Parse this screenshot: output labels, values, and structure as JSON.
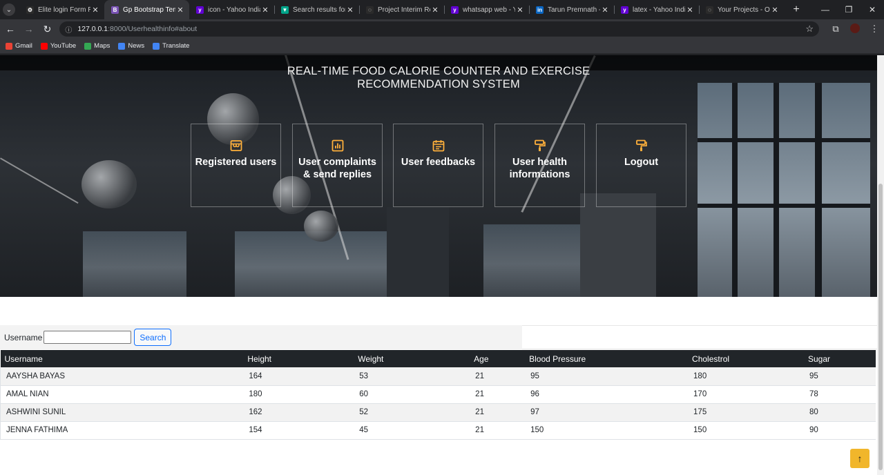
{
  "browser": {
    "tabs": [
      {
        "label": "Elite login Form Resp",
        "active": false,
        "favicon_color": "#2b2b2b",
        "favicon_glyph": "⚙"
      },
      {
        "label": "Gp Bootstrap Templat",
        "active": true,
        "favicon_color": "#7952b3",
        "favicon_glyph": "B"
      },
      {
        "label": "icon - Yahoo India Se",
        "active": false,
        "favicon_color": "#6001d2",
        "favicon_glyph": "y"
      },
      {
        "label": "Search results for Cal",
        "active": false,
        "favicon_color": "#00a389",
        "favicon_glyph": "▼"
      },
      {
        "label": "Project Interim Repor",
        "active": false,
        "favicon_color": "#2b2b2b",
        "favicon_glyph": "◌"
      },
      {
        "label": "whatsapp web - Yaho",
        "active": false,
        "favicon_color": "#6001d2",
        "favicon_glyph": "y"
      },
      {
        "label": "Tarun Premnath - Ch",
        "active": false,
        "favicon_color": "#0a66c2",
        "favicon_glyph": "in"
      },
      {
        "label": "latex - Yahoo India Se",
        "active": false,
        "favicon_color": "#6001d2",
        "favicon_glyph": "y"
      },
      {
        "label": "Your Projects - Overle",
        "active": false,
        "favicon_color": "#2b2b2b",
        "favicon_glyph": "◌"
      }
    ],
    "url_host": "127.0.0.1",
    "url_path": ":8000/Userhealthinfo#about",
    "bookmarks": [
      {
        "label": "Gmail",
        "color": "#ea4335"
      },
      {
        "label": "YouTube",
        "color": "#ff0000"
      },
      {
        "label": "Maps",
        "color": "#34a853"
      },
      {
        "label": "News",
        "color": "#4285f4"
      },
      {
        "label": "Translate",
        "color": "#4285f4"
      }
    ]
  },
  "hero": {
    "title_line1": "REAL-TIME FOOD CALORIE COUNTER AND EXERCISE",
    "title_line2": "RECOMMENDATION SYSTEM",
    "accent_color": "#ffb03b",
    "cards": [
      {
        "label": "Registered users",
        "icon": "store-icon"
      },
      {
        "label": "User complaints & send replies",
        "icon": "bar-chart-icon"
      },
      {
        "label": "User feedbacks",
        "icon": "calendar-icon"
      },
      {
        "label": "User health informations",
        "icon": "paint-roller-icon"
      },
      {
        "label": "Logout",
        "icon": "paint-roller-icon"
      }
    ]
  },
  "search": {
    "label": "Username",
    "value": "",
    "button_label": "Search"
  },
  "table": {
    "columns": [
      "Username",
      "Height",
      "Weight",
      "Age",
      "Blood Pressure",
      "Cholestrol",
      "Sugar"
    ],
    "rows": [
      [
        "AAYSHA BAYAS",
        "164",
        "53",
        "21",
        "95",
        "180",
        "95"
      ],
      [
        "AMAL NIAN",
        "180",
        "60",
        "21",
        "96",
        "170",
        "78"
      ],
      [
        "ASHWINI SUNIL",
        "162",
        "52",
        "21",
        "97",
        "175",
        "80"
      ],
      [
        "JENNA FATHIMA",
        "154",
        "45",
        "21",
        "150",
        "150",
        "90"
      ]
    ]
  },
  "back_to_top": {
    "icon": "arrow-up-icon",
    "color": "#f1b62b"
  }
}
